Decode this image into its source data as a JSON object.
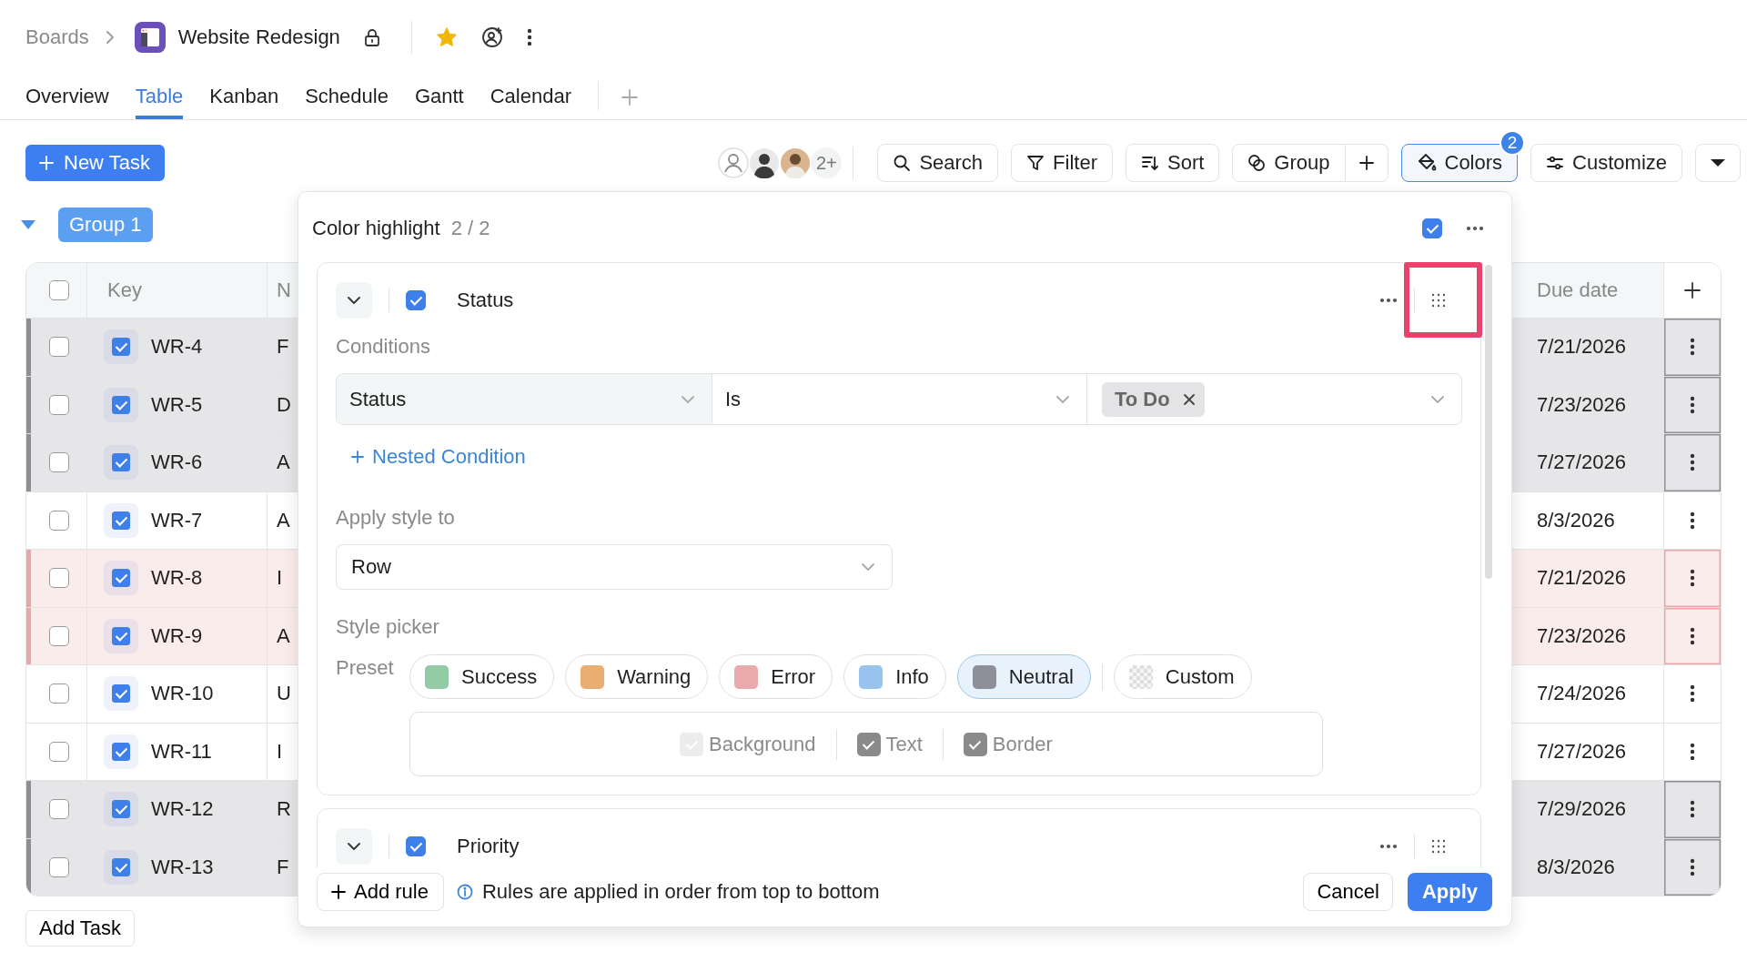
{
  "header": {
    "breadcrumb": "Boards",
    "board_title": "Website Redesign",
    "starred": true
  },
  "tabs": [
    {
      "label": "Overview",
      "selected": false
    },
    {
      "label": "Table",
      "selected": true
    },
    {
      "label": "Kanban",
      "selected": false
    },
    {
      "label": "Schedule",
      "selected": false
    },
    {
      "label": "Gantt",
      "selected": false
    },
    {
      "label": "Calendar",
      "selected": false
    }
  ],
  "toolbar": {
    "new_task": "New Task",
    "members_more": "2+",
    "buttons": [
      {
        "kind": "search",
        "label": "Search",
        "selected": false
      },
      {
        "kind": "filter",
        "label": "Filter",
        "selected": false
      },
      {
        "kind": "sort",
        "label": "Sort",
        "selected": false
      },
      {
        "kind": "group",
        "label": "Group",
        "selected": false
      },
      {
        "kind": "colors",
        "label": "Colors",
        "selected": true,
        "badge": "2"
      },
      {
        "kind": "customize",
        "label": "Customize",
        "selected": false
      }
    ]
  },
  "group": {
    "label": "Group 1",
    "expanded": true
  },
  "table": {
    "all_selected": false,
    "columns": [
      "Key",
      "N",
      "Due date"
    ],
    "rows": [
      {
        "key": "WR-4",
        "name": "F",
        "due": "7/21/2026",
        "color": "#8e8e96",
        "selected": false,
        "done": true
      },
      {
        "key": "WR-5",
        "name": "D",
        "due": "7/23/2026",
        "color": "#8e8e96",
        "selected": false,
        "done": true
      },
      {
        "key": "WR-6",
        "name": "A",
        "due": "7/27/2026",
        "color": "#8e8e96",
        "selected": false,
        "done": true
      },
      {
        "key": "WR-7",
        "name": "A",
        "due": "8/3/2026",
        "selected": false,
        "done": true
      },
      {
        "key": "WR-8",
        "name": "I",
        "due": "7/21/2026",
        "color": "#eba7a7",
        "selected": false,
        "done": true
      },
      {
        "key": "WR-9",
        "name": "A",
        "due": "7/23/2026",
        "color": "#eba7a7",
        "selected": false,
        "done": true
      },
      {
        "key": "WR-10",
        "name": "U",
        "due": "7/24/2026",
        "selected": false,
        "done": true
      },
      {
        "key": "WR-11",
        "name": "I",
        "due": "7/27/2026",
        "selected": false,
        "done": true
      },
      {
        "key": "WR-12",
        "name": "R",
        "due": "7/29/2026",
        "color": "#8e8e96",
        "selected": false,
        "done": true
      },
      {
        "key": "WR-13",
        "name": "F",
        "due": "8/3/2026",
        "color": "#8e8e96",
        "selected": false,
        "done": true
      }
    ]
  },
  "add_task": "Add Task",
  "color_panel": {
    "title": "Color highlight",
    "count": "2 / 2",
    "enabled": true,
    "rules": [
      {
        "field": "Status",
        "enabled": true,
        "conditions_label": "Conditions",
        "condition": {
          "field": "Status",
          "operator": "Is",
          "values": [
            "To Do"
          ]
        },
        "nested_link": "Nested Condition",
        "apply_label": "Apply style to",
        "apply_to": "Row",
        "style_label": "Style picker",
        "preset_label": "Preset",
        "presets": [
          {
            "kind": "swatch",
            "label": "Success",
            "color": "#93cba6",
            "selected": false
          },
          {
            "kind": "swatch",
            "label": "Warning",
            "color": "#eaae73",
            "selected": false
          },
          {
            "kind": "swatch",
            "label": "Error",
            "color": "#eaa9aa",
            "selected": false
          },
          {
            "kind": "swatch",
            "label": "Info",
            "color": "#98c3ee",
            "selected": false
          },
          {
            "kind": "swatch",
            "label": "Neutral",
            "color": "#8f8f99",
            "selected": true
          },
          {
            "kind": "custom",
            "label": "Custom",
            "selected": false
          }
        ],
        "targets": [
          {
            "label": "Background",
            "checked": true,
            "disabled": true
          },
          {
            "label": "Text",
            "checked": true,
            "disabled": false
          },
          {
            "label": "Border",
            "checked": true,
            "disabled": false
          }
        ]
      },
      {
        "field": "Priority",
        "enabled": true
      }
    ],
    "add_rule": "Add rule",
    "info": "Rules are applied in order from top to bottom",
    "cancel": "Cancel",
    "apply": "Apply"
  }
}
